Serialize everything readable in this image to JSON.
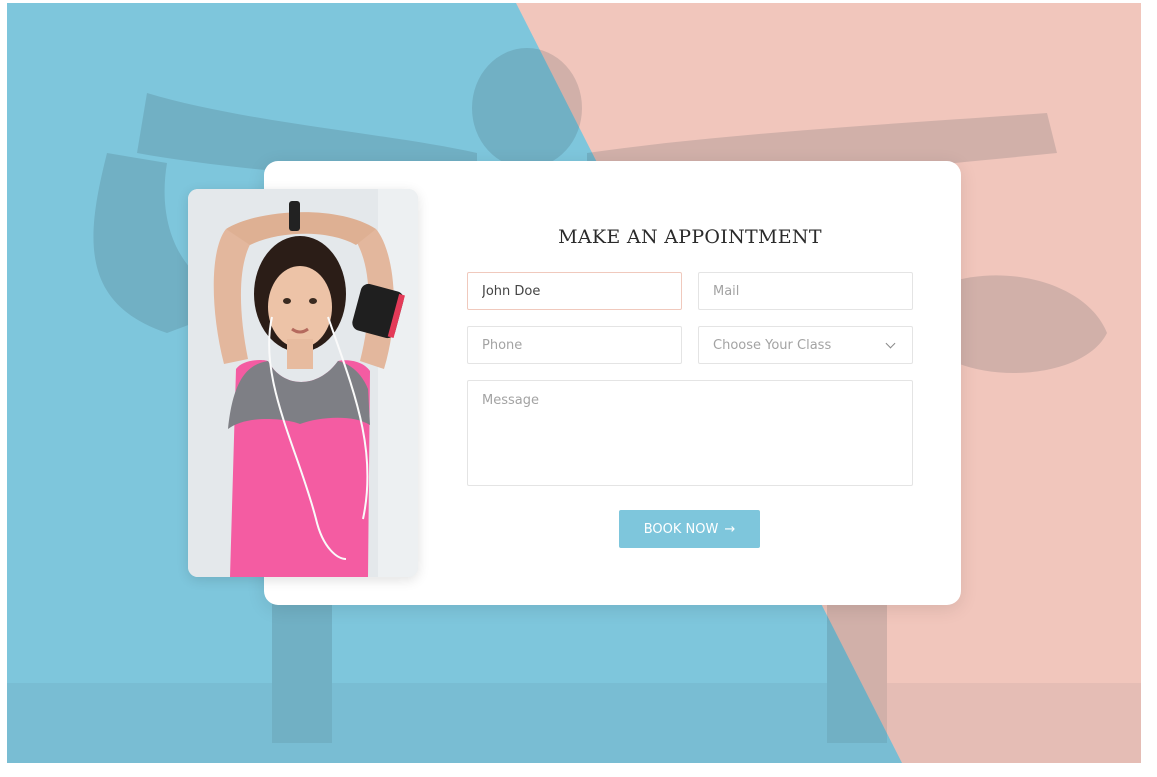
{
  "form": {
    "title": "MAKE AN APPOINTMENT",
    "name_value": "John Doe",
    "mail_placeholder": "Mail",
    "phone_placeholder": "Phone",
    "class_select_value": "Choose Your Class",
    "message_placeholder": "Message",
    "submit_label": "BOOK NOW",
    "submit_icon": "arrow-right-icon",
    "submit_arrow": "→"
  },
  "colors": {
    "background_blue": "#7ec6dc",
    "background_coral": "#f1c6bc",
    "button": "#7ec6dc",
    "card": "#ffffff",
    "shirt_pink": "#f45ca2"
  }
}
